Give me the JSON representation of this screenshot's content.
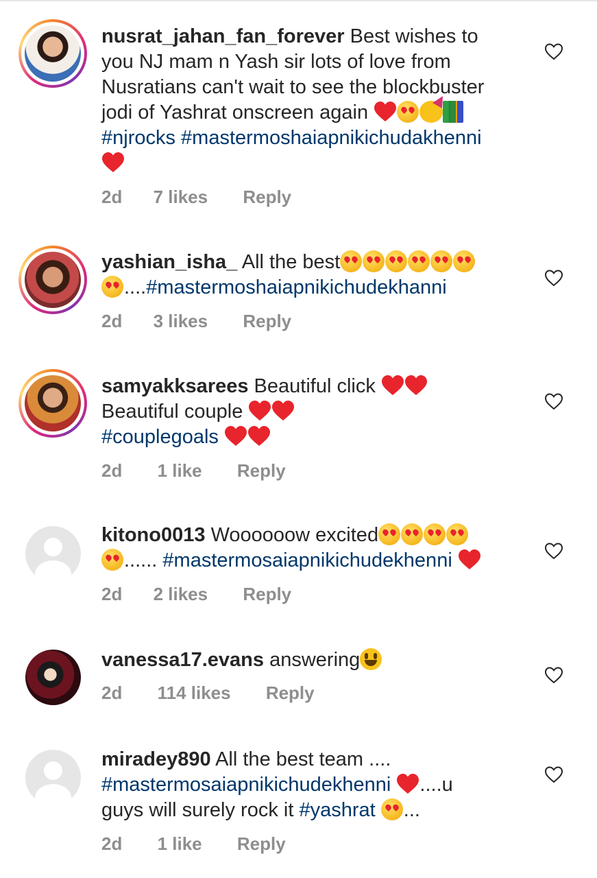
{
  "comments": [
    {
      "username": "nusrat_jahan_fan_forever",
      "text_lines": [
        "Best wishes to",
        "you NJ mam n Yash sir lots of love from",
        "Nusratians can't wait to see the blockbuster",
        "jodi of Yashrat onscreen again"
      ],
      "hashtags": "#njrocks #mastermoshaiapnikichudakhenni",
      "time": "2d",
      "likes": "7 likes",
      "reply": "Reply",
      "avatar": "story-ring-photo"
    },
    {
      "username": "yashian_isha_",
      "text": "All the best",
      "dots": "....",
      "hashtags": "#mastermoshaiapnikichudekhanni",
      "time": "2d",
      "likes": "3 likes",
      "reply": "Reply",
      "avatar": "story-ring-photo"
    },
    {
      "username": "samyakksarees",
      "line1": "Beautiful click",
      "line2": "Beautiful couple",
      "hashtags": "#couplegoals",
      "time": "2d",
      "likes": "1 like",
      "reply": "Reply",
      "avatar": "story-ring-photo"
    },
    {
      "username": "kitono0013",
      "text": "Woooooow excited",
      "dots": "......",
      "hashtags": "#mastermosaiapnikichudekhenni",
      "time": "2d",
      "likes": "2 likes",
      "reply": "Reply",
      "avatar": "default-avatar"
    },
    {
      "username": "vanessa17.evans",
      "text": "answering",
      "time": "2d",
      "likes": "114 likes",
      "reply": "Reply",
      "avatar": "photo"
    },
    {
      "username": "miradey890",
      "text": "All the best team ....",
      "hashtags": "#mastermosaiapnikichudekhenni",
      "after_heart": "....u",
      "line3_text": "guys will surely rock it",
      "line3_tag": "#yashrat",
      "trailing": "...",
      "time": "2d",
      "likes": "1 like",
      "reply": "Reply",
      "avatar": "default-avatar"
    }
  ],
  "colors": {
    "text": "#262626",
    "meta": "#8e8e8e",
    "hashtag": "#00376b",
    "heart": "#e8242c"
  },
  "icons": {
    "like": "heart-outline-icon"
  }
}
